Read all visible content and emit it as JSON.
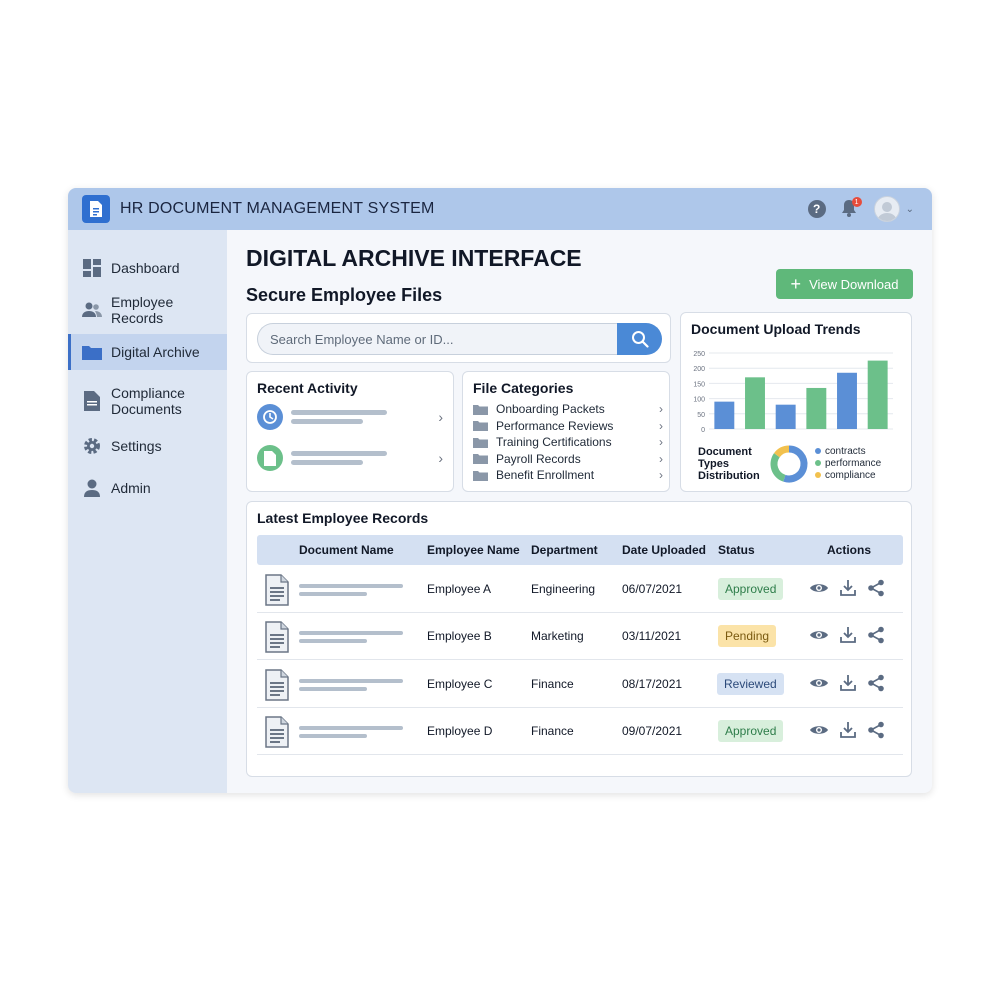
{
  "header": {
    "title": "HR DOCUMENT MANAGEMENT SYSTEM",
    "notifications": "1"
  },
  "sidebar": {
    "items": [
      {
        "label": "Dashboard",
        "icon": "dashboard-icon"
      },
      {
        "label": "Employee Records",
        "icon": "people-icon"
      },
      {
        "label": "Digital Archive",
        "icon": "folder-icon",
        "active": true
      },
      {
        "label": "Compliance\nDocuments",
        "icon": "document-icon"
      },
      {
        "label": "Settings",
        "icon": "gear-icon"
      },
      {
        "label": "Admin",
        "icon": "person-icon"
      }
    ]
  },
  "main": {
    "title": "DIGITAL ARCHIVE INTERFACE",
    "subtitle": "Secure Employee Files",
    "view_download_label": "View Download"
  },
  "search": {
    "placeholder": "Search Employee Name or ID..."
  },
  "recent_activity": {
    "title": "Recent Activity"
  },
  "file_categories": {
    "title": "File Categories",
    "items": [
      "Onboarding Packets",
      "Performance Reviews",
      "Training Certifications",
      "Payroll Records",
      "Benefit Enrollment"
    ]
  },
  "upload_trends": {
    "title": "Document Upload Trends",
    "distribution_label": "Document Types Distribution",
    "legend": [
      "contracts",
      "performance",
      "compliance"
    ]
  },
  "chart_data": [
    {
      "type": "bar",
      "title": "Document Upload Trends",
      "ylim": [
        0,
        250
      ],
      "yticks": [
        "250",
        "200",
        "150",
        "100",
        "50",
        "0"
      ],
      "values": [
        90,
        170,
        80,
        135,
        185,
        225
      ],
      "colors": [
        "#5b8fd6",
        "#6cc08a",
        "#5b8fd6",
        "#6cc08a",
        "#5b8fd6",
        "#6cc08a"
      ],
      "grid": true
    },
    {
      "type": "pie",
      "title": "Document Types Distribution",
      "categories": [
        "contracts",
        "performance",
        "compliance"
      ],
      "values": [
        55,
        30,
        15
      ],
      "colors": [
        "#5b8fd6",
        "#6cc08a",
        "#f2c14e"
      ]
    }
  ],
  "records": {
    "title": "Latest Employee Records",
    "headers": [
      "Document Name",
      "Employee Name",
      "Department",
      "Date Uploaded",
      "Status",
      "Actions"
    ],
    "rows": [
      {
        "employee": "Employee A",
        "department": "Engineering",
        "date": "06/07/2021",
        "status": "Approved",
        "status_bg": "#d8efdc",
        "status_color": "#2e7d4a"
      },
      {
        "employee": "Employee B",
        "department": "Marketing",
        "date": "03/11/2021",
        "status": "Pending",
        "status_bg": "#fbe3a8",
        "status_color": "#7a5a10"
      },
      {
        "employee": "Employee C",
        "department": "Finance",
        "date": "08/17/2021",
        "status": "Reviewed",
        "status_bg": "#d6e2f3",
        "status_color": "#2c4a7a"
      },
      {
        "employee": "Employee D",
        "department": "Finance",
        "date": "09/07/2021",
        "status": "Approved",
        "status_bg": "#d8efdc",
        "status_color": "#2e7d4a"
      }
    ]
  },
  "colors": {
    "accent": "#4a89d6",
    "header_bg": "#aec7ea",
    "sidebar_bg": "#dde6f3",
    "success": "#5fb87a"
  }
}
